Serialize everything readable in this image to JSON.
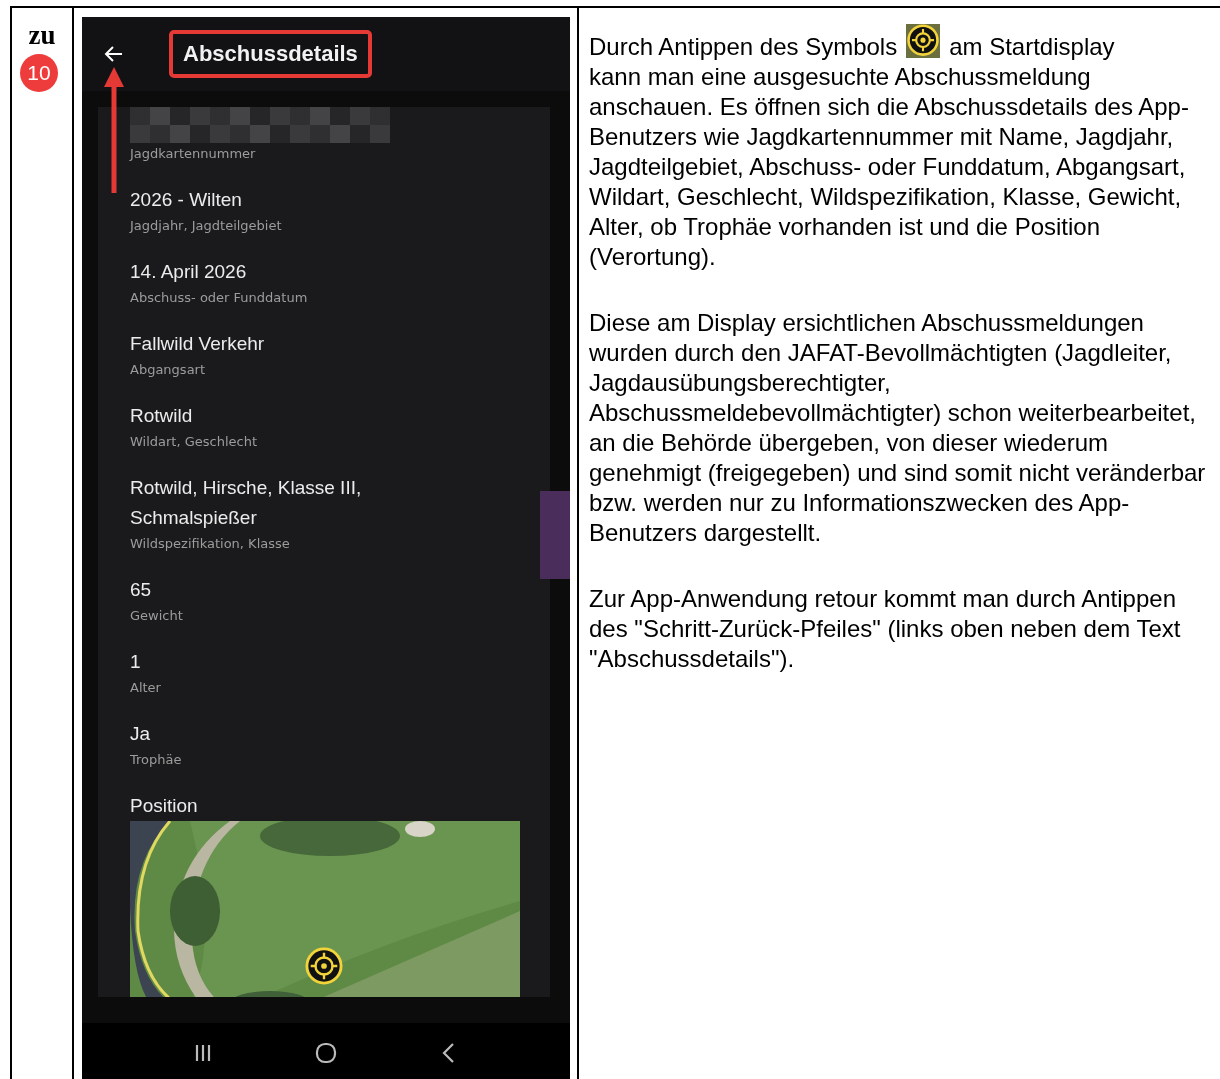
{
  "step": {
    "prefix": "zu",
    "number": "10"
  },
  "app": {
    "title": "Abschussdetails",
    "fields": [
      {
        "kind": "redacted",
        "label": "Jagdkartennummer"
      },
      {
        "kind": "text",
        "value": "2026 - Wilten",
        "label": "Jagdjahr, Jagdteilgebiet"
      },
      {
        "kind": "text",
        "value": "14. April 2026",
        "label": "Abschuss- oder Funddatum"
      },
      {
        "kind": "text",
        "value": "Fallwild Verkehr",
        "label": "Abgangsart"
      },
      {
        "kind": "text",
        "value": "Rotwild",
        "label": "Wildart, Geschlecht"
      },
      {
        "kind": "text",
        "value": "Rotwild, Hirsche, Klasse III, Schmalspießer",
        "label": "Wildspezifikation, Klasse"
      },
      {
        "kind": "text",
        "value": "65",
        "label": "Gewicht"
      },
      {
        "kind": "text",
        "value": "1",
        "label": "Alter"
      },
      {
        "kind": "text",
        "value": "Ja",
        "label": "Trophäe"
      },
      {
        "kind": "map",
        "value": "Position"
      }
    ]
  },
  "description": {
    "first_before_icon": "Durch Antippen des Symbols",
    "first_after_icon": "am Startdisplay",
    "first_rest": "kann man eine ausgesuchte Abschussmeldung anschauen. Es öffnen sich die Abschussdetails des App-Benutzers wie Jagdkartennummer mit Name, Jagdjahr, Jagdteilgebiet, Abschuss- oder Funddatum, Abgangsart, Wildart, Geschlecht, Wildspezifikation, Klasse, Gewicht, Alter, ob Trophäe vorhanden ist und die Position (Verortung).",
    "paragraphs": [
      "Diese am Display ersichtlichen Abschussmeldungen wurden durch den JAFAT-Bevollmächtigten (Jagdleiter, Jagdausübungsberechtigter, Abschussmeldebevollmächtigter) schon weiterbearbeitet, an die Behörde übergeben, von dieser wiederum genehmigt (freigegeben) und sind somit nicht veränderbar bzw. werden nur zu Informationszwecken des App-Benutzers dargestellt.",
      "Zur App-Anwendung retour kommt man durch Antippen des \"Schritt-Zurück-Pfeiles\" (links oben neben dem Text \"Abschussdetails\")."
    ]
  }
}
